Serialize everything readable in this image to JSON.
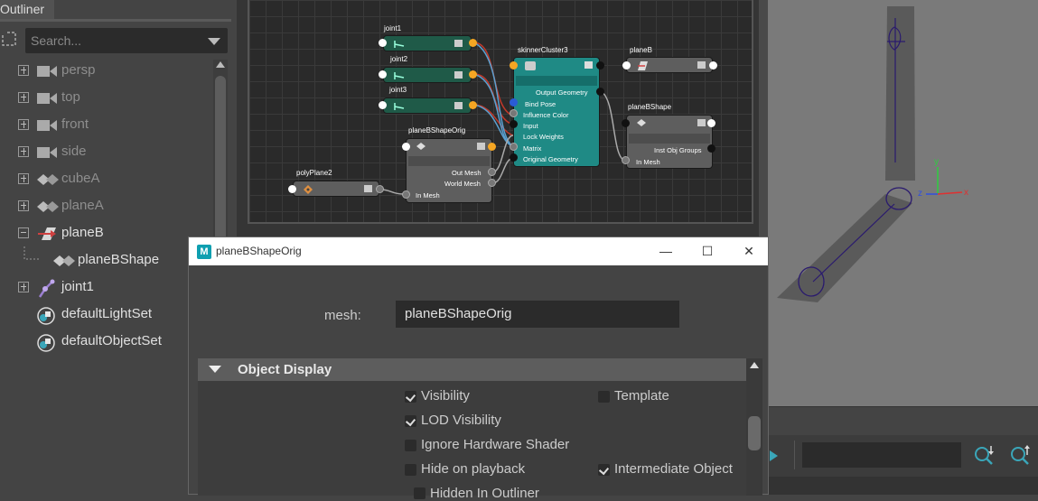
{
  "outliner": {
    "tab_label": "Outliner",
    "search_placeholder": "Search...",
    "items": [
      {
        "label": "persp",
        "icon": "camera-icon",
        "state": "collapsed"
      },
      {
        "label": "top",
        "icon": "camera-icon",
        "state": "collapsed"
      },
      {
        "label": "front",
        "icon": "camera-icon",
        "state": "collapsed"
      },
      {
        "label": "side",
        "icon": "camera-icon",
        "state": "collapsed"
      },
      {
        "label": "cubeA",
        "icon": "mesh-icon",
        "state": "collapsed"
      },
      {
        "label": "planeA",
        "icon": "mesh-icon",
        "state": "collapsed"
      },
      {
        "label": "planeB",
        "icon": "transform-icon",
        "state": "expanded"
      },
      {
        "label": "planeBShape",
        "icon": "mesh-icon",
        "state": "child"
      },
      {
        "label": "joint1",
        "icon": "joint-icon",
        "state": "collapsed"
      },
      {
        "label": "defaultLightSet",
        "icon": "set-icon",
        "state": "none"
      },
      {
        "label": "defaultObjectSet",
        "icon": "set-icon",
        "state": "none"
      }
    ]
  },
  "node_editor": {
    "nodes": {
      "joint1": "joint1",
      "joint2": "joint2",
      "joint3": "joint3",
      "skinner": "skinnerCluster3",
      "planeB": "planeB",
      "planeBShape": "planeBShape",
      "planeBShapeOrig": "planeBShapeOrig",
      "polyPlane2": "polyPlane2"
    },
    "skinner_attrs": [
      "Output Geometry",
      "Bind Pose",
      "Influence Color",
      "Input",
      "Lock Weights",
      "Matrix",
      "Original Geometry"
    ],
    "orig_attrs": [
      "Out Mesh",
      "World Mesh",
      "In Mesh"
    ],
    "shape_attrs": [
      "Inst Obj Groups",
      "In Mesh"
    ]
  },
  "viewport": {
    "axis_y": "y",
    "axis_z": "z",
    "axis_x": "x"
  },
  "attribute_window": {
    "title": "planeBShapeOrig",
    "minimize": "—",
    "maximize": "☐",
    "close": "✕",
    "mesh_label": "mesh:",
    "mesh_value": "planeBShapeOrig",
    "section_title": "Object Display",
    "checkboxes": [
      {
        "label": "Visibility",
        "checked": true
      },
      {
        "label": "Template",
        "checked": false
      },
      {
        "label": "LOD Visibility",
        "checked": true
      },
      {
        "label": "Ignore Hardware Shader",
        "checked": false
      },
      {
        "label": "Hide on playback",
        "checked": false
      },
      {
        "label": "Intermediate Object",
        "checked": true
      },
      {
        "label": "Hidden In Outliner",
        "checked": false
      }
    ]
  },
  "colors": {
    "skin_node": "#1f8a85",
    "joint_node": "#1f5a48",
    "default_node": "#5e5e5e",
    "connection_red": "#c0392b",
    "connection_blue": "#5aa0d0"
  }
}
